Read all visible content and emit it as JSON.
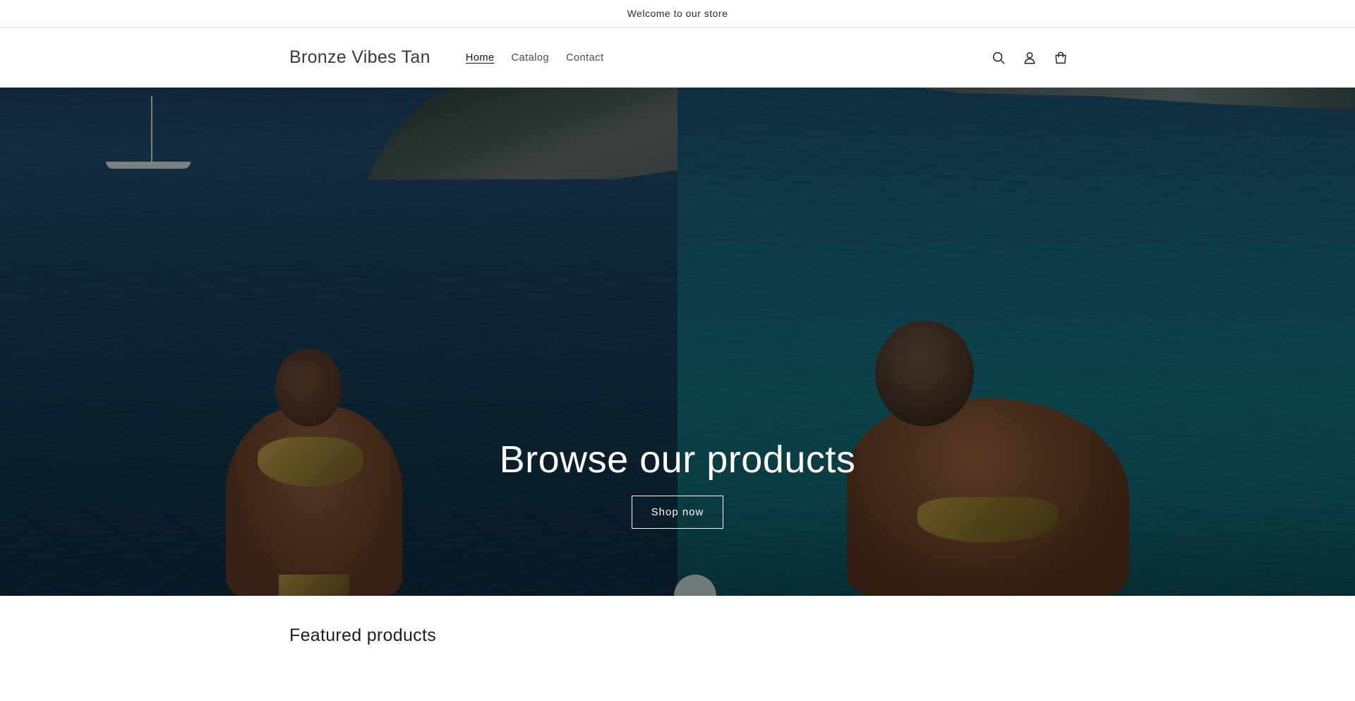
{
  "announcement": {
    "text": "Welcome to our store"
  },
  "header": {
    "logo": "Bronze Vibes Tan",
    "nav": [
      {
        "label": "Home",
        "active": true
      },
      {
        "label": "Catalog",
        "active": false
      },
      {
        "label": "Contact",
        "active": false
      }
    ],
    "icons": [
      "search-icon",
      "account-icon",
      "cart-icon"
    ]
  },
  "hero": {
    "heading": "Browse our products",
    "button_label": "Shop now"
  },
  "featured": {
    "title": "Featured products"
  },
  "colors": {
    "text": "#121212",
    "overlay": "rgba(0,0,0,0.38)",
    "hero_button_border": "#ffffff"
  }
}
